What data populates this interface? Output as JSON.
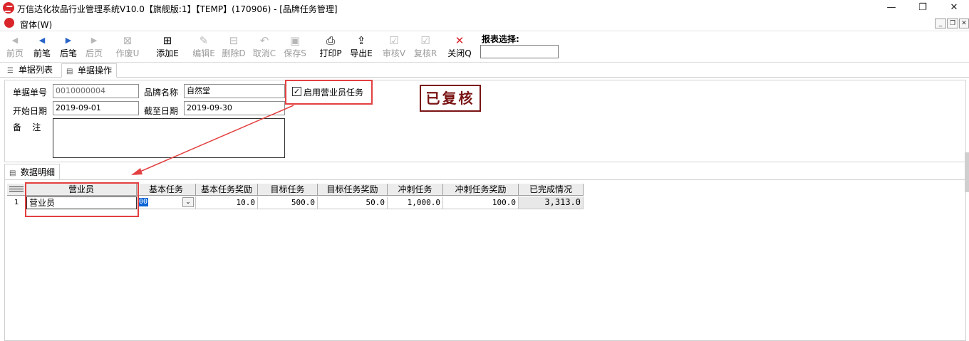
{
  "window": {
    "title": "万信达化妆品行业管理系统V10.0【旗舰版:1】【TEMP】(170906) - [品牌任务管理]",
    "min_glyph": "—",
    "max_glyph": "❐",
    "close_glyph": "✕"
  },
  "menu": {
    "window_label": "窗体(W)",
    "mdi_min": "_",
    "mdi_restore": "❐",
    "mdi_close": "✕"
  },
  "toolbar": {
    "buttons": [
      {
        "label": "前页",
        "icon": "first-page-icon",
        "glyph": "◀",
        "enabled": false
      },
      {
        "label": "前笔",
        "icon": "prev-record-icon",
        "glyph": "◀",
        "enabled": true
      },
      {
        "label": "后笔",
        "icon": "next-record-icon",
        "glyph": "▶",
        "enabled": true
      },
      {
        "label": "后页",
        "icon": "last-page-icon",
        "glyph": "▶",
        "enabled": false
      },
      {
        "label": "作废U",
        "icon": "void-icon",
        "glyph": "⊠",
        "enabled": false
      },
      {
        "label": "添加E",
        "icon": "add-icon",
        "glyph": "⊞",
        "enabled": true
      },
      {
        "label": "编辑E",
        "icon": "edit-icon",
        "glyph": "✎",
        "enabled": false
      },
      {
        "label": "删除D",
        "icon": "delete-icon",
        "glyph": "⊟",
        "enabled": false
      },
      {
        "label": "取消C",
        "icon": "undo-icon",
        "glyph": "↶",
        "enabled": false
      },
      {
        "label": "保存S",
        "icon": "save-icon",
        "glyph": "▣",
        "enabled": false
      },
      {
        "label": "打印P",
        "icon": "print-icon",
        "glyph": "⎙",
        "enabled": true
      },
      {
        "label": "导出E",
        "icon": "export-icon",
        "glyph": "⇪",
        "enabled": true
      },
      {
        "label": "审核V",
        "icon": "audit-icon",
        "glyph": "☑",
        "enabled": false
      },
      {
        "label": "复核R",
        "icon": "recheck-icon",
        "glyph": "☑",
        "enabled": false
      },
      {
        "label": "关闭Q",
        "icon": "close-icon",
        "glyph": "✕",
        "enabled": true
      }
    ],
    "report_select_label": "报表选择:",
    "report_select_value": ""
  },
  "tabs": [
    {
      "label": "单据列表",
      "icon": "list-icon",
      "active": false
    },
    {
      "label": "单据操作",
      "icon": "document-icon",
      "active": true
    }
  ],
  "form": {
    "doc_no_label": "单据单号",
    "doc_no": "0010000004",
    "brand_label": "品牌名称",
    "brand": "自然堂",
    "start_label": "开始日期",
    "start": "2019-09-01",
    "end_label": "截至日期",
    "end": "2019-09-30",
    "remark_label": "备    注",
    "remark": "",
    "enable_salesman_task_label": "启用营业员任务",
    "enable_salesman_task_checked": true,
    "check_glyph": "✓",
    "status_stamp": "已复核"
  },
  "detail": {
    "tab_label": "数据明细",
    "columns": [
      "营业员",
      "基本任务",
      "基本任务奖励",
      "目标任务",
      "目标任务奖励",
      "冲刺任务",
      "冲刺任务奖励",
      "已完成情况"
    ],
    "rows": [
      {
        "index": "1",
        "salesman": "营业员",
        "basic_task": "00",
        "basic_reward": "10.0",
        "target_task": "500.0",
        "target_reward": "50.0",
        "sprint_task": "1,000.0",
        "sprint_reward": "100.0",
        "completed": "3,313.0"
      }
    ],
    "dropdown_glyph": "⌄"
  },
  "colors": {
    "highlight_red": "#e34040",
    "stamp": "#7a1414",
    "selection_blue": "#0a64d6"
  }
}
